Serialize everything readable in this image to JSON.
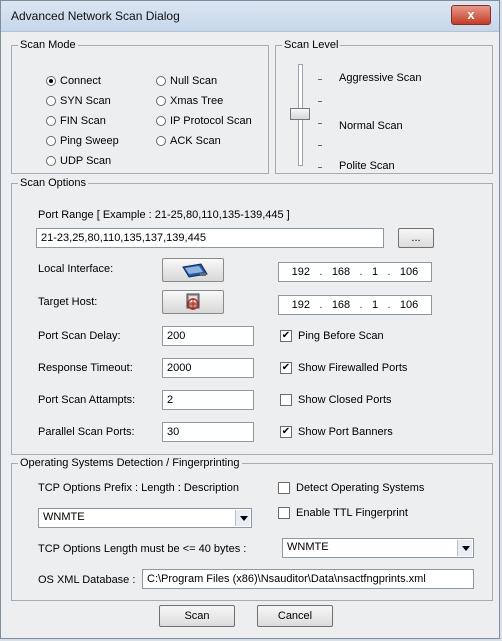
{
  "window": {
    "title": "Advanced Network Scan Dialog",
    "close_label": "x"
  },
  "scan_mode": {
    "legend": "Scan Mode",
    "options": [
      {
        "label": "Connect",
        "checked": true
      },
      {
        "label": "SYN  Scan",
        "checked": false
      },
      {
        "label": "FIN   Scan",
        "checked": false
      },
      {
        "label": "Ping  Sweep",
        "checked": false
      },
      {
        "label": "UDP  Scan",
        "checked": false
      },
      {
        "label": "Null Scan",
        "checked": false
      },
      {
        "label": "Xmas Tree",
        "checked": false
      },
      {
        "label": "IP Protocol Scan",
        "checked": false
      },
      {
        "label": "ACK Scan",
        "checked": false
      }
    ]
  },
  "scan_level": {
    "legend": "Scan Level",
    "levels": [
      "Aggressive Scan",
      "Normal  Scan",
      "Polite  Scan"
    ],
    "selected": "Normal  Scan"
  },
  "scan_options": {
    "legend": "Scan Options",
    "port_range_label": "Port Range  [ Example :  21-25,80,110,135-139,445 ]",
    "port_range_value": "21-23,25,80,110,135,137,139,445",
    "browse_label": "...",
    "local_interface_label": "Local Interface:",
    "target_host_label": "Target Host:",
    "local_ip": [
      "192",
      "168",
      "1",
      "106"
    ],
    "target_ip": [
      "192",
      "168",
      "1",
      "106"
    ],
    "port_scan_delay_label": "Port Scan Delay:",
    "port_scan_delay_value": "200",
    "response_timeout_label": "Response Timeout:",
    "response_timeout_value": "2000",
    "port_scan_attempts_label": "Port Scan Attampts:",
    "port_scan_attempts_value": "2",
    "parallel_scan_ports_label": "Parallel Scan Ports:",
    "parallel_scan_ports_value": "30",
    "checkboxes": [
      {
        "label": "Ping Before Scan",
        "checked": true
      },
      {
        "label": "Show Firewalled Ports",
        "checked": true
      },
      {
        "label": "Show Closed Ports",
        "checked": false
      },
      {
        "label": "Show Port Banners",
        "checked": true
      }
    ]
  },
  "os_detection": {
    "legend": "Operating Systems Detection / Fingerprinting",
    "tcp_prefix_label": "TCP Options Prefix : Length  : Description",
    "tcp_prefix_value": "WNMTE",
    "tcp_length_label": "TCP Options Length must be <= 40 bytes :",
    "tcp_length_value": "WNMTE",
    "detect_os_label": "Detect Operating Systems",
    "detect_os_checked": false,
    "ttl_label": "Enable TTL Fingerprint",
    "ttl_checked": false,
    "os_xml_label": "OS XML Database :",
    "os_xml_value": "C:\\Program Files (x86)\\Nsauditor\\Data\\nsactfngprints.xml"
  },
  "buttons": {
    "scan": "Scan",
    "cancel": "Cancel"
  }
}
